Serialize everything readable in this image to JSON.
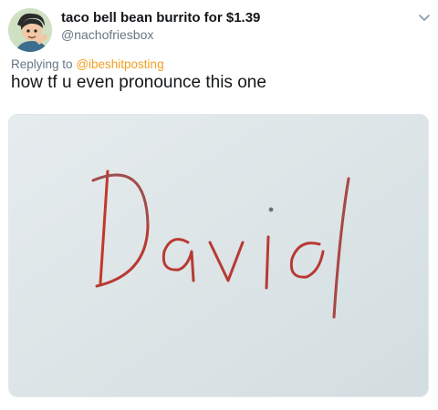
{
  "tweet": {
    "display_name": "taco bell bean burrito for $1.39",
    "handle": "@nachofriesbox",
    "replying_prefix": "Replying to",
    "replying_to": "@ibeshitposting",
    "text": "how tf u even pronounce this one",
    "menu_icon": "chevron-down-icon",
    "avatar_icon": "cartoon-avatar"
  },
  "media": {
    "handwritten_word": "David",
    "background_color": "#d9e3e6",
    "ink_color_red": "#c0392b",
    "ink_color_gray": "#6b6f78"
  }
}
